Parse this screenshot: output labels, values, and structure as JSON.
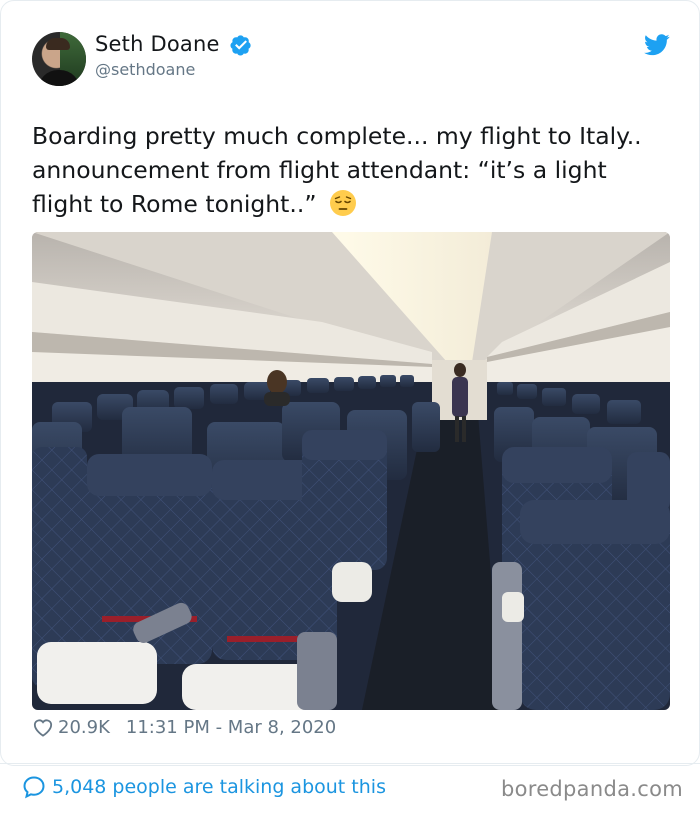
{
  "tweet": {
    "author_name": "Seth Doane",
    "author_handle": "@sethdoane",
    "verified": true,
    "text": "Boarding pretty much complete... my flight to Italy.. announcement from flight attendant: “it’s a light flight to Rome tonight..”",
    "emoji": "pensive-face",
    "likes": "20.9K",
    "timestamp": "11:31 PM - Mar 8, 2020",
    "talking": "5,048 people are talking about this"
  },
  "photo": {
    "description_icon": "airplane-cabin-photo"
  },
  "watermark": "boredpanda.com",
  "colors": {
    "twitter_blue": "#1da1f2",
    "link_blue": "#1b95e0",
    "muted": "#657786",
    "seat_navy": "#2f3d57"
  }
}
